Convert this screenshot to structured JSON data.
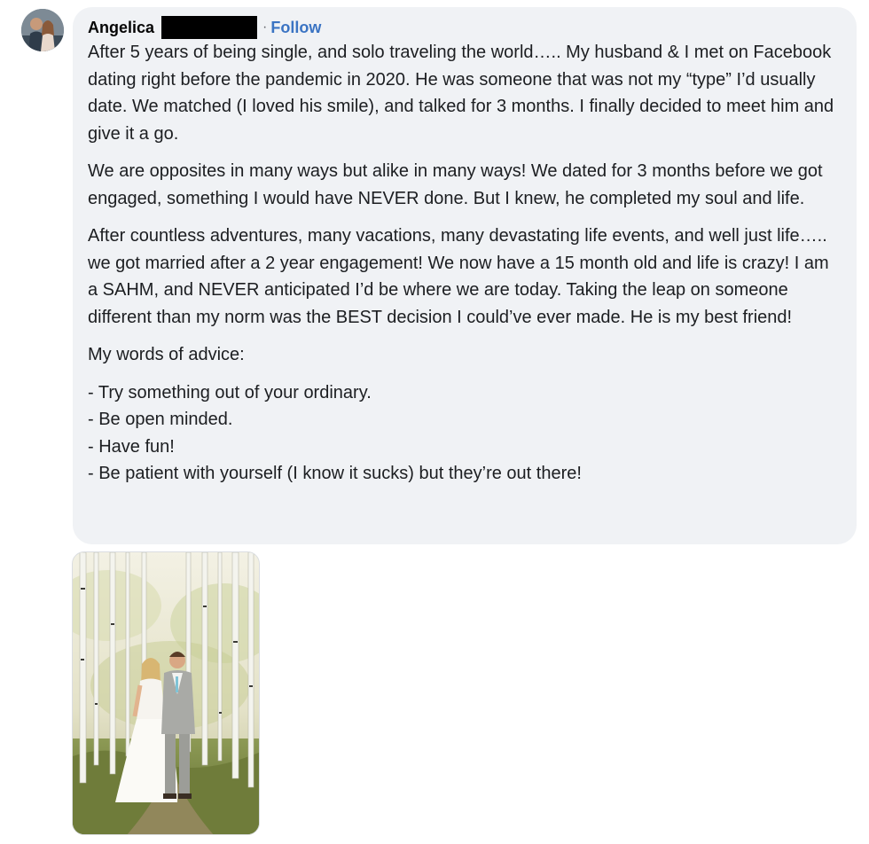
{
  "comment": {
    "author_name": "Angelica",
    "separator": "·",
    "follow_label": "Follow",
    "paragraphs": [
      "After 5 years of being single, and solo traveling the world….. My husband & I met on Facebook dating right before the pandemic in 2020. He was someone that was not my “type” I’d usually date. We matched (I loved his smile), and talked for 3 months. I finally decided to meet him and give it a go.",
      "We are opposites in many ways but alike in many ways! We dated for 3 months before we got engaged, something I would have NEVER done. But I knew, he completed my soul and life.",
      "After countless adventures, many vacations, many devastating life events, and well just life….. we got married after a 2 year engagement! We now have a 15 month old and life is crazy! I am a SAHM, and NEVER anticipated I’d be where we are today. Taking the leap on someone different than my norm was the BEST decision I could’ve ever made. He is my best friend!",
      "My words of advice:"
    ],
    "advice": [
      "- Try something out of your ordinary.",
      "- Be open minded.",
      "- Have fun!",
      "- Be patient with yourself (I know it sucks) but they’re out there!"
    ]
  },
  "colors": {
    "bubble_background": "#f0f2f5",
    "follow_link": "#3b74c3",
    "text": "#1c1e21"
  },
  "icons": {
    "avatar": "profile-photo-couple",
    "attachment": "wedding-photo-birch-forest"
  }
}
